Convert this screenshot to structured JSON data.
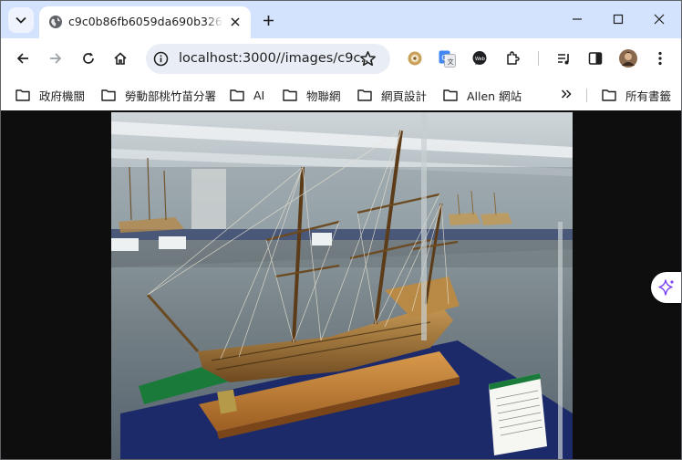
{
  "tab": {
    "title": "c9c0b86fb6059da690b32660",
    "favicon": "globe-icon"
  },
  "window_controls": [
    "minimize-icon",
    "maximize-icon",
    "close-icon"
  ],
  "toolbar": {
    "url": "localhost:3000//images/c9c...",
    "extensions": [
      "cookie-extension-icon",
      "google-translate-icon",
      "chat-extension-icon",
      "puzzle-extensions-icon",
      "media-control-icon",
      "side-panel-icon",
      "profile-avatar",
      "more-menu-icon"
    ]
  },
  "bookmarks": {
    "items": [
      {
        "label": "政府機關"
      },
      {
        "label": "勞動部桃竹苗分署"
      },
      {
        "label": "AI"
      },
      {
        "label": "物聯網"
      },
      {
        "label": "網頁設計"
      },
      {
        "label": "Allen 網站"
      }
    ],
    "all_bookmarks": "所有書籤"
  },
  "content": {
    "image_subject": "ship-model-photo"
  },
  "colors": {
    "tabstrip": "#d3e3fd",
    "omnibox": "#e9eef6",
    "page_background": "#0e0e0e",
    "gemini_accent": "#7b3ff2"
  }
}
